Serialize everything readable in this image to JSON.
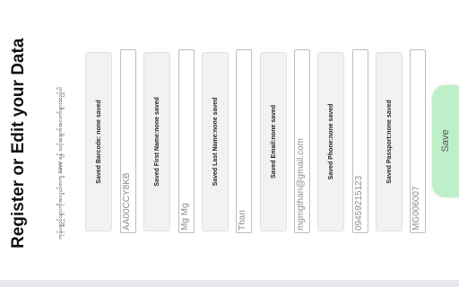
{
  "header": {
    "title": "Register or Edit your Data",
    "subtitle": "ကုန်ပစ္စည်းများကိုအလွယ်တကူ save ရန် သင့်အချက်အလက်များထည့်ပါ"
  },
  "fields": [
    {
      "saved_label": "Saved Barcode: none saved",
      "value": "AA00CCY8KB"
    },
    {
      "saved_label": "Saved First Name:none saved",
      "value": "Mg Mg"
    },
    {
      "saved_label": "Saved Last Name:none saved",
      "value": "Than"
    },
    {
      "saved_label": "Saved Email:none saved",
      "value": "mgmgthan@gmail.com"
    },
    {
      "saved_label": "Saved Phone:none saved",
      "value": "09459215123"
    },
    {
      "saved_label": "Saved Passport:none saved",
      "value": "MG006007"
    }
  ],
  "save_button": {
    "label": "Save",
    "color": "#bdf0c9"
  }
}
